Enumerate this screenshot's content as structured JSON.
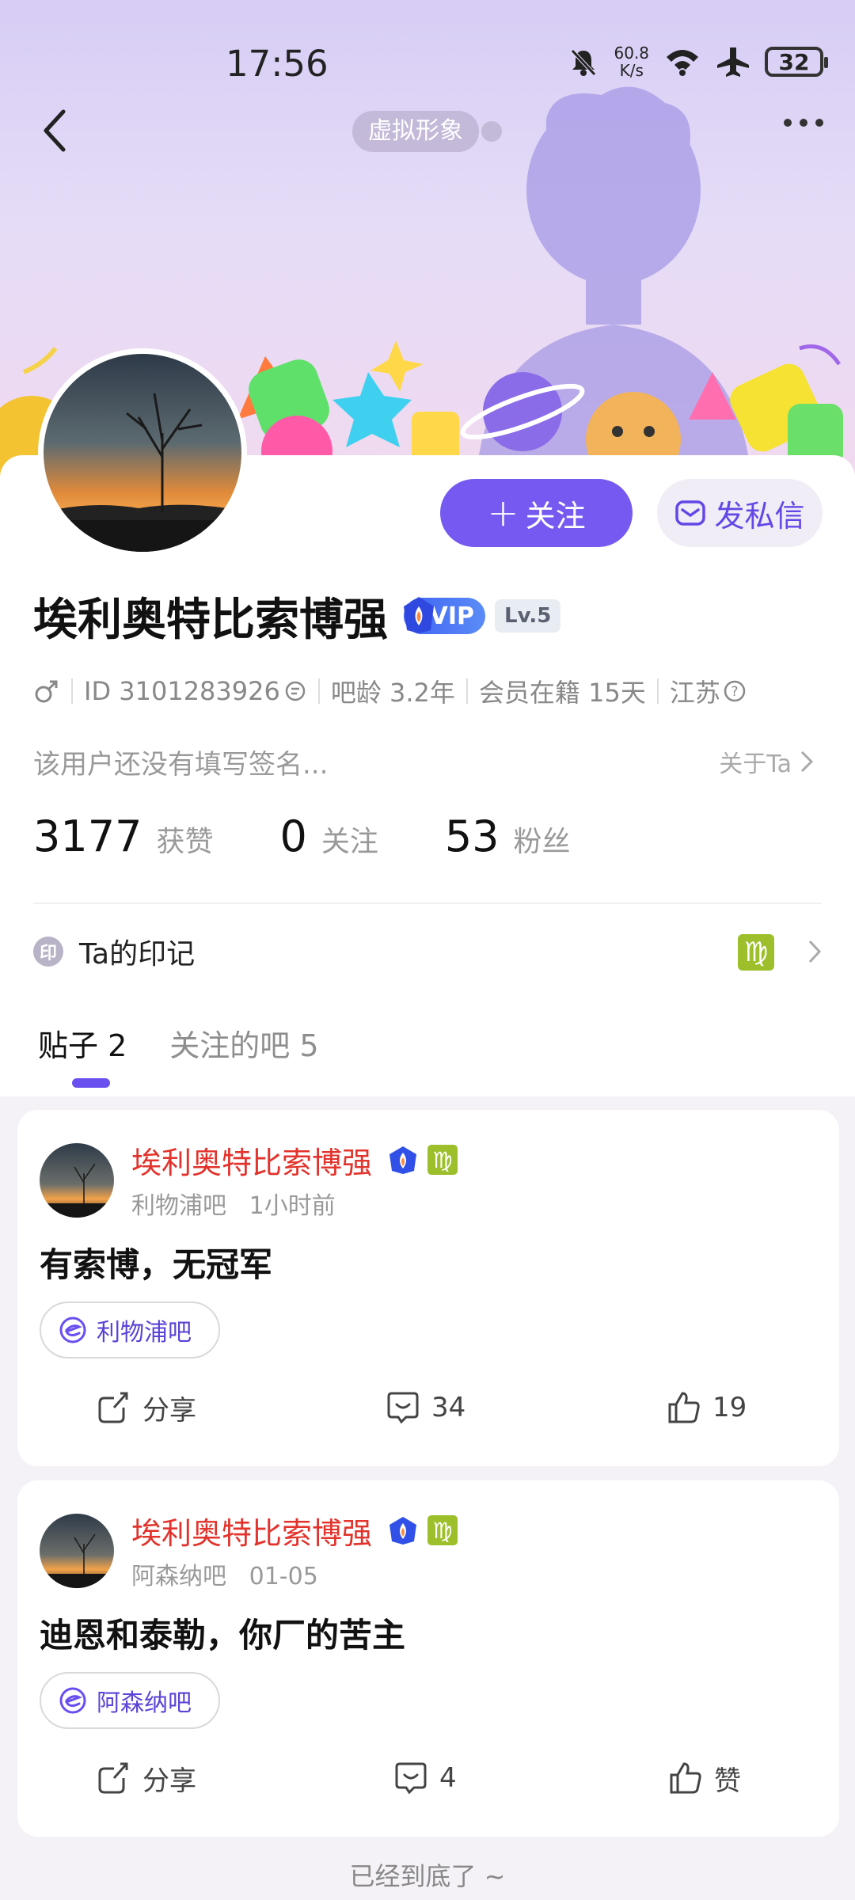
{
  "status_bar": {
    "time": "17:56",
    "net_speed_value": "60.8",
    "net_speed_unit": "K/s",
    "battery": "32"
  },
  "header": {
    "avatar_tag": "虚拟形象"
  },
  "profile": {
    "username": "埃利奥特比索博强",
    "vip_label": "VIP",
    "level": "Lv.5",
    "id_text": "ID 3101283926",
    "bar_age": "吧龄 3.2年",
    "membership": "会员在籍 15天",
    "location": "江苏",
    "signature": "该用户还没有填写签名...",
    "about": "关于Ta"
  },
  "buttons": {
    "follow": "关注",
    "message": "发私信"
  },
  "stats": [
    {
      "num": "3177",
      "label": "获赞"
    },
    {
      "num": "0",
      "label": "关注"
    },
    {
      "num": "53",
      "label": "粉丝"
    }
  ],
  "mark": {
    "icon_text": "印",
    "label": "Ta的印记",
    "zodiac": "♍"
  },
  "tabs": [
    {
      "label": "贴子 2"
    },
    {
      "label": "关注的吧 5"
    }
  ],
  "posts": [
    {
      "author": "埃利奥特比索博强",
      "bar": "利物浦吧",
      "time": "1小时前",
      "title": "有索博，无冠军",
      "bar_tag": "利物浦吧",
      "share": "分享",
      "comments": "34",
      "likes": "19"
    },
    {
      "author": "埃利奥特比索博强",
      "bar": "阿森纳吧",
      "time": "01-05",
      "title": "迪恩和泰勒，你厂的苦主",
      "bar_tag": "阿森纳吧",
      "share": "分享",
      "comments": "4",
      "likes": "赞"
    }
  ],
  "footer": "已经到底了 ~",
  "colors": {
    "accent": "#7559f1",
    "author_red": "#e2332c",
    "zodiac_green": "#9cbf2b"
  }
}
